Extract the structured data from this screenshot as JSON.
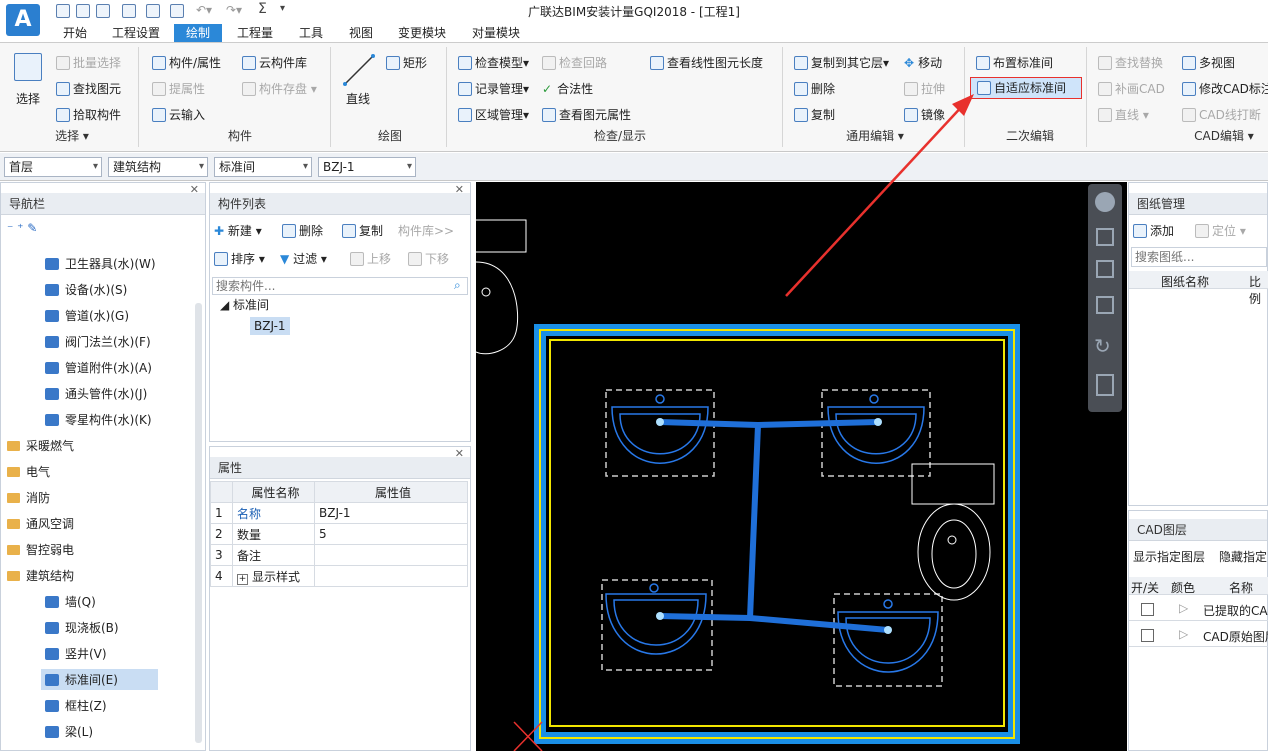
{
  "app": {
    "title": "广联达BIM安装计量GQI2018 - [工程1]",
    "logo_letter": "A"
  },
  "menu_tabs": [
    "开始",
    "工程设置",
    "绘制",
    "工程量",
    "工具",
    "视图",
    "变更模块",
    "对量模块"
  ],
  "ribbon": {
    "select": {
      "label": "选择",
      "batch": "批量选择",
      "find": "查找图元",
      "pick": "拾取构件",
      "group": "选择 ▾"
    },
    "component": {
      "prop": "构件/属性",
      "cloud_lib": "云构件库",
      "extract": "提属性",
      "cloud_save": "构件存盘",
      "cloud_input": "云输入",
      "group": "构件"
    },
    "draw": {
      "line": "直线",
      "rect": "矩形",
      "group": "绘图"
    },
    "check": {
      "check_model": "检查模型",
      "check_loop": "检查回路",
      "view_len": "查看线性图元长度",
      "record": "记录管理",
      "legal": "合法性",
      "area": "区域管理",
      "view_prop": "查看图元属性",
      "group": "检查/显示"
    },
    "edit": {
      "copy_to": "复制到其它层",
      "move": "移动",
      "delete": "删除",
      "stretch": "拉伸",
      "copy": "复制",
      "mirror": "镜像",
      "group": "通用编辑 ▾"
    },
    "second": {
      "place": "布置标准间",
      "adapt": "自适应标准间",
      "group": "二次编辑"
    },
    "cad": {
      "find_replace": "查找替换",
      "multi_view": "多视图",
      "fill_cad": "补画CAD",
      "modify_cad": "修改CAD标注",
      "line": "直线",
      "cad_break": "CAD线打断",
      "group": "CAD编辑 ▾"
    }
  },
  "combos": [
    "首层",
    "建筑结构",
    "标准间",
    "BZJ-1"
  ],
  "nav": {
    "title": "导航栏",
    "items": [
      {
        "label": "卫生器具(水)(W)",
        "type": "item"
      },
      {
        "label": "设备(水)(S)",
        "type": "item"
      },
      {
        "label": "管道(水)(G)",
        "type": "item"
      },
      {
        "label": "阀门法兰(水)(F)",
        "type": "item"
      },
      {
        "label": "管道附件(水)(A)",
        "type": "item"
      },
      {
        "label": "通头管件(水)(J)",
        "type": "item"
      },
      {
        "label": "零星构件(水)(K)",
        "type": "item"
      },
      {
        "label": "采暖燃气",
        "type": "folder"
      },
      {
        "label": "电气",
        "type": "folder"
      },
      {
        "label": "消防",
        "type": "folder"
      },
      {
        "label": "通风空调",
        "type": "folder"
      },
      {
        "label": "智控弱电",
        "type": "folder"
      },
      {
        "label": "建筑结构",
        "type": "folder-open"
      },
      {
        "label": "墙(Q)",
        "type": "item"
      },
      {
        "label": "现浇板(B)",
        "type": "item"
      },
      {
        "label": "竖井(V)",
        "type": "item"
      },
      {
        "label": "标准间(E)",
        "type": "selected"
      },
      {
        "label": "框柱(Z)",
        "type": "item"
      },
      {
        "label": "梁(L)",
        "type": "item"
      }
    ]
  },
  "complist": {
    "title": "构件列表",
    "new": "新建",
    "delete": "删除",
    "copy": "复制",
    "lib": "构件库>>",
    "sort": "排序",
    "filter": "过滤",
    "up": "上移",
    "down": "下移",
    "search_placeholder": "搜索构件...",
    "tree_root": "标准间",
    "tree_child": "BZJ-1"
  },
  "props": {
    "title": "属性",
    "col_name": "属性名称",
    "col_value": "属性值",
    "rows": [
      {
        "idx": "1",
        "name": "名称",
        "value": "BZJ-1"
      },
      {
        "idx": "2",
        "name": "数量",
        "value": "5"
      },
      {
        "idx": "3",
        "name": "备注",
        "value": ""
      },
      {
        "idx": "4",
        "name": "显示样式",
        "value": ""
      }
    ]
  },
  "drawings": {
    "title": "图纸管理",
    "add": "添加",
    "locate": "定位",
    "search_placeholder": "搜索图纸...",
    "col_name": "图纸名称",
    "col_scale": "比例"
  },
  "cadlayer": {
    "title": "CAD图层",
    "show_layer": "显示指定图层",
    "hide_layer": "隐藏指定",
    "col_onoff": "开/关",
    "col_color": "颜色",
    "col_name": "名称",
    "rows": [
      "已提取的CAD",
      "CAD原始图层"
    ]
  },
  "colors": {
    "accent": "#2b88d8",
    "canvas": "#000000",
    "room_border": "#1a8fe6",
    "room_inner": "#f2e600",
    "pipe": "#1f6fd8",
    "annotation": "#e8312d"
  }
}
